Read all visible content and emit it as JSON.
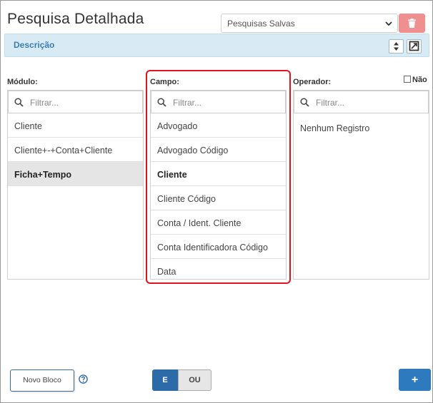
{
  "header": {
    "title": "Pesquisa Detalhada"
  },
  "saved_searches": {
    "value": "Pesquisas Salvas"
  },
  "description_bar": {
    "label": "Descrição"
  },
  "modulo": {
    "label": "Módulo:",
    "filter_placeholder": "Filtrar...",
    "items": [
      {
        "label": "Cliente"
      },
      {
        "label": "Cliente+-+Conta+Cliente"
      },
      {
        "label": "Ficha+Tempo"
      }
    ]
  },
  "campo": {
    "label": "Campo:",
    "filter_placeholder": "Filtrar...",
    "items": [
      {
        "label": "Advogado"
      },
      {
        "label": "Advogado Código"
      },
      {
        "label": "Cliente"
      },
      {
        "label": "Cliente Código"
      },
      {
        "label": "Conta / Ident. Cliente"
      },
      {
        "label": "Conta Identificadora Código"
      },
      {
        "label": "Data"
      }
    ]
  },
  "operador": {
    "label": "Operador:",
    "negate_label": "Não",
    "filter_placeholder": "Filtrar...",
    "empty_text": "Nenhum Registro"
  },
  "footer": {
    "new_block": "Novo Bloco",
    "logic_and": "E",
    "logic_or": "OU",
    "add": "+"
  },
  "colors": {
    "accent": "#2d6aa8",
    "description_bg": "#d8ebf5",
    "delete_button": "#ef8f8f",
    "highlight_outline": "#e0141c"
  }
}
